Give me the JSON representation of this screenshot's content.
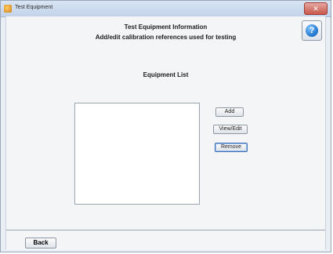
{
  "window": {
    "title": "Test Equipment",
    "close_glyph": "✕",
    "icon": "app-icon"
  },
  "header": {
    "title": "Test Equipment Information",
    "subtitle": "Add/edit calibration references used for testing",
    "help_glyph": "?"
  },
  "main": {
    "list_title": "Equipment List",
    "items": [],
    "buttons": {
      "add": "Add",
      "view_edit": "View/Edit",
      "remove": "Remove"
    }
  },
  "footer": {
    "back_label": "Back"
  },
  "colors": {
    "accent": "#1f73c9",
    "close": "#c9574c"
  }
}
